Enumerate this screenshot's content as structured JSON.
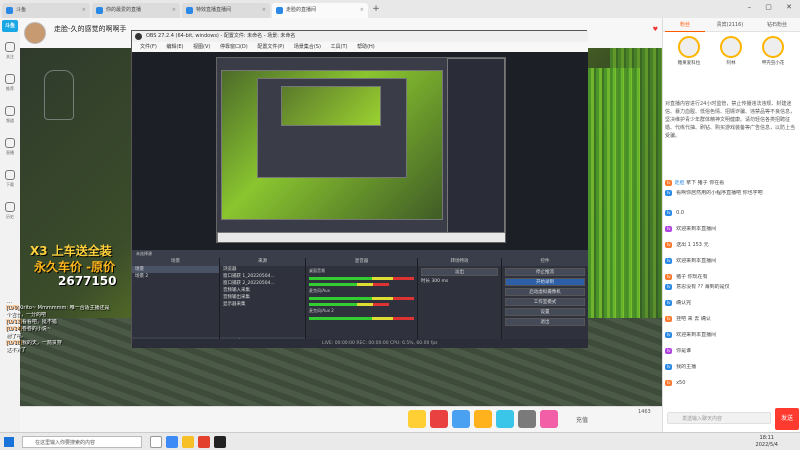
{
  "browser": {
    "tabs": [
      {
        "label": "斗鱼"
      },
      {
        "label": "你的最爱的直播"
      },
      {
        "label": "特效直播直播间"
      },
      {
        "label": "走脸的直播间"
      }
    ],
    "plus": "+"
  },
  "sidebar": {
    "logo": "斗鱼",
    "items": [
      {
        "label": "关注"
      },
      {
        "label": "推荐"
      },
      {
        "label": "频道"
      },
      {
        "label": "直播"
      },
      {
        "label": "下载"
      },
      {
        "label": "历史"
      }
    ]
  },
  "stream": {
    "title": "走脸-久的感觉的啊啊手"
  },
  "overlay": {
    "line1": "X3 上车送全装",
    "line2": "永久车价 -原价",
    "amount": "2677150"
  },
  "obs": {
    "title": "OBS 27.2.4 (64-bit, windows) - 配置文件: 未命名 - 场景: 未命名",
    "menu": [
      "文件(F)",
      "编辑(E)",
      "视图(V)",
      "停靠窗口(D)",
      "配置文件(P)",
      "场景集合(S)",
      "工具(T)",
      "帮助(H)"
    ],
    "scene_bar": "未选择源",
    "docks": {
      "scenes_title": "场景",
      "scenes": [
        "场景",
        "场景 2"
      ],
      "sources_title": "来源",
      "sources": [
        "浏览器",
        "窗口捕获 1_20220504...",
        "窗口捕获 2_20220504...",
        "音频输入采集",
        "音频输出采集",
        "显示器采集"
      ],
      "mixer_title": "混音器",
      "mixer": [
        "桌面音频",
        "麦克风/Aux",
        "麦克风/Aux 2"
      ],
      "transitions_title": "转场特效",
      "transition_value": "淡出",
      "duration_label": "时长",
      "duration_value": "300 ms",
      "controls_title": "控件",
      "controls": [
        "停止推流",
        "开始录制",
        "启动虚拟摄像机",
        "工作室模式",
        "设置",
        "退出"
      ]
    },
    "status": "LIVE: 00:00:00    REC: 00:00:00    CPU: 6.5%, 60.00 fps"
  },
  "left_chat": [
    {
      "user": "",
      "text": "…"
    },
    {
      "user": "[LV9]",
      "text": "Kirito~ Mmmmmm: 唯一合适主播还是"
    },
    {
      "user": "",
      "text": "个吉普，一分的吧"
    },
    {
      "user": "[LV13]",
      "text": "看看吧，挺不错"
    },
    {
      "user": "[LV14]",
      "text": "卷卷的小说~"
    },
    {
      "user": "",
      "text": "射了吧。"
    },
    {
      "user": "[LV10]",
      "text": "我的天，一箭贯穿"
    },
    {
      "user": "",
      "text": "这不对了"
    }
  ],
  "giftbar": {
    "recharge_label": "充值",
    "count_label": "1463"
  },
  "right_panel": {
    "tabs": [
      {
        "label": "粉丝"
      },
      {
        "label": "贵宾(2116)"
      },
      {
        "label": "钻石粉丝"
      }
    ],
    "ranks": [
      {
        "name": "糖果爱科拉"
      },
      {
        "name": "阿林"
      },
      {
        "name": "甲壳虫小花"
      }
    ],
    "notice": "对直播内容进行24小时监管，禁止传播违法违规、封建迷信、暴力血腥、低俗色情、招嫖诈骗、违禁品等不良信息，坚决维护青少年群体精神文明健康。请勿轻信各类招聘征婚、代练代抽、刷钻、购买游戏装备等广告信息，以防上当受骗。",
    "chat": [
      {
        "badge": "lv",
        "user": "走脸",
        "text": "拿下 猪子 你在看"
      },
      {
        "badge": "lv",
        "user": "",
        "text": "看啊你居然用的小程序直播吧 你也学吧"
      },
      {
        "badge": "lv",
        "user": "",
        "text": "0.0"
      },
      {
        "badge": "lv",
        "user": "",
        "text": "欢迎来到本直播间"
      },
      {
        "badge": "lv",
        "user": "",
        "text": "送出 1 153 元"
      },
      {
        "badge": "lv",
        "user": "",
        "text": "欢迎来到本直播间"
      },
      {
        "badge": "lv",
        "user": "",
        "text": "猪子 你现在有"
      },
      {
        "badge": "lv",
        "user": "",
        "text": "意思没有 ?? 海到的是仅"
      },
      {
        "badge": "lv",
        "user": "",
        "text": "确认完"
      },
      {
        "badge": "lv",
        "user": "",
        "text": "挂吧 来 去 确认"
      },
      {
        "badge": "lv",
        "user": "",
        "text": "欢迎来到本直播间"
      },
      {
        "badge": "lv",
        "user": "",
        "text": "你是谁"
      },
      {
        "badge": "lv",
        "user": "",
        "text": "我的主播"
      },
      {
        "badge": "lv",
        "user": "",
        "text": "x50"
      }
    ],
    "input_placeholder": "发送输入聊天内容",
    "send_label": "发送"
  },
  "taskbar": {
    "search_placeholder": "在这里输入你要搜索的内容",
    "time": "18:11",
    "date": "2022/5/4"
  }
}
